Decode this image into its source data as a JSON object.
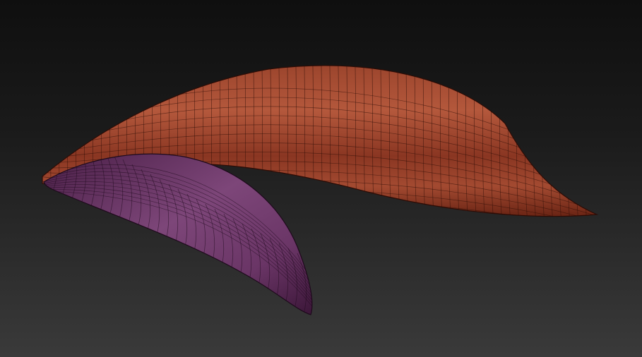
{
  "viewport": {
    "background_top": "#0f0f0f",
    "background_bottom": "#3a3a3a"
  },
  "models": [
    {
      "id": "red-mesh",
      "shape": "elongated crescent subdivided mesh",
      "base_color": "#8a3a25",
      "highlight_color": "#c46245",
      "shadow_color": "#5a1e12",
      "wire_color": "#2c0c06"
    },
    {
      "id": "purple-mesh",
      "shape": "curved horn subdivided mesh",
      "base_color": "#5f2c5a",
      "highlight_color": "#8a4e88",
      "shadow_color": "#3a1536",
      "wire_color": "#1e0a1c"
    }
  ],
  "wireframe_visible": true
}
